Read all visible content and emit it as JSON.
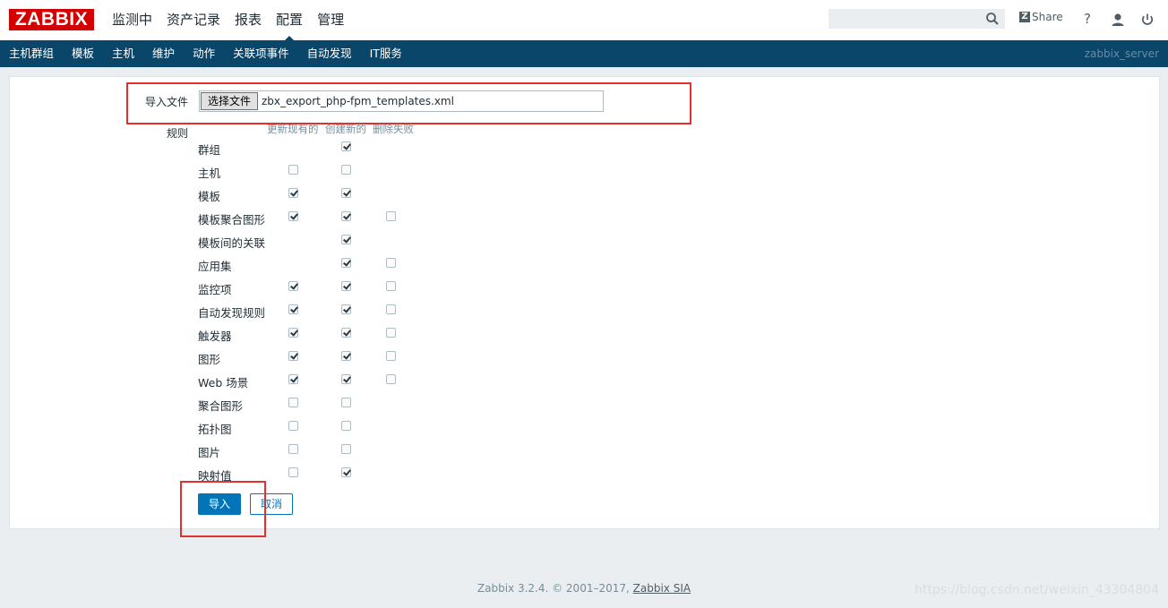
{
  "header": {
    "logo": "ZABBIX",
    "menu": [
      {
        "label": "监测中"
      },
      {
        "label": "资产记录"
      },
      {
        "label": "报表"
      },
      {
        "label": "配置",
        "active": true
      },
      {
        "label": "管理"
      }
    ],
    "search": {
      "value": "",
      "placeholder": ""
    },
    "share_label": "Share",
    "help_icon": "help-icon",
    "user_icon": "user-icon",
    "logout_icon": "power-icon"
  },
  "subnav": {
    "items": [
      "主机群组",
      "模板",
      "主机",
      "维护",
      "动作",
      "关联项事件",
      "自动发现",
      "IT服务"
    ],
    "server": "zabbix_server"
  },
  "form": {
    "import_file_label": "导入文件",
    "file_button": "选择文件",
    "file_name": "zbx_export_php-fpm_templates.xml",
    "rules_label": "规则",
    "columns": [
      "更新现有的",
      "创建新的",
      "删除失败"
    ],
    "rules": [
      {
        "label": "群组",
        "update": null,
        "create": true,
        "delete": null
      },
      {
        "label": "主机",
        "update": false,
        "create": false,
        "delete": null
      },
      {
        "label": "模板",
        "update": true,
        "create": true,
        "delete": null
      },
      {
        "label": "模板聚合图形",
        "update": true,
        "create": true,
        "delete": false
      },
      {
        "label": "模板间的关联",
        "update": null,
        "create": true,
        "delete": null
      },
      {
        "label": "应用集",
        "update": null,
        "create": true,
        "delete": false
      },
      {
        "label": "监控项",
        "update": true,
        "create": true,
        "delete": false
      },
      {
        "label": "自动发现规则",
        "update": true,
        "create": true,
        "delete": false
      },
      {
        "label": "触发器",
        "update": true,
        "create": true,
        "delete": false
      },
      {
        "label": "图形",
        "update": true,
        "create": true,
        "delete": false
      },
      {
        "label": "Web 场景",
        "update": true,
        "create": true,
        "delete": false
      },
      {
        "label": "聚合图形",
        "update": false,
        "create": false,
        "delete": null
      },
      {
        "label": "拓扑图",
        "update": false,
        "create": false,
        "delete": null
      },
      {
        "label": "图片",
        "update": false,
        "create": false,
        "delete": null
      },
      {
        "label": "映射值",
        "update": false,
        "create": true,
        "delete": null
      }
    ],
    "import_button": "导入",
    "cancel_button": "取消"
  },
  "footer": {
    "text": "Zabbix 3.2.4. © 2001–2017,",
    "link": "Zabbix SIA"
  },
  "watermark": "https://blog.csdn.net/weixin_43304804"
}
